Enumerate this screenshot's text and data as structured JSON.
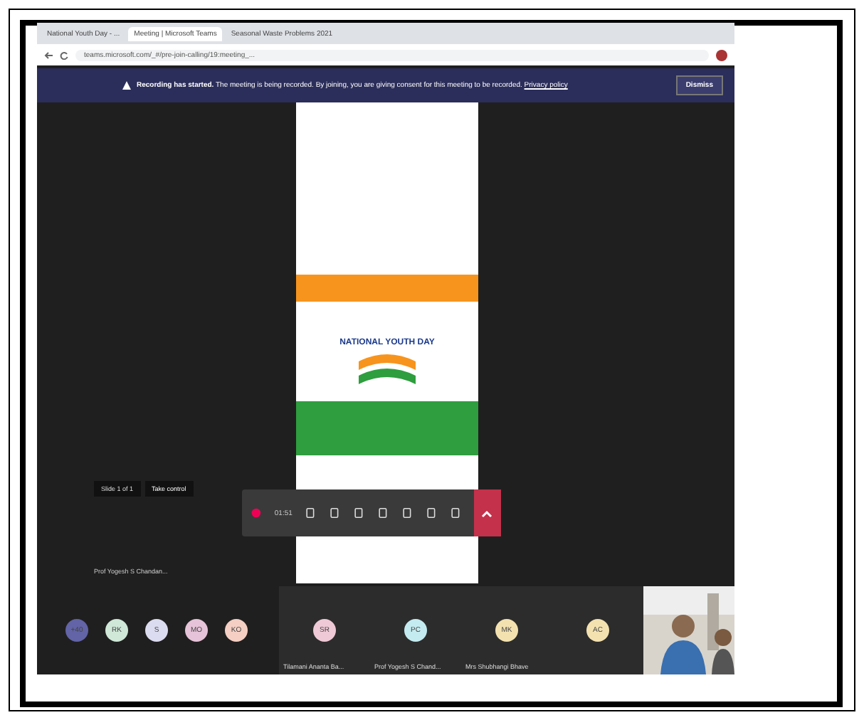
{
  "browser": {
    "tabs": [
      {
        "title": "National Youth Day - ...",
        "selected": false
      },
      {
        "title": "Meeting | Microsoft Teams",
        "selected": true
      },
      {
        "title": "Seasonal Waste Problems 2021",
        "selected": false
      }
    ],
    "address_bar": {
      "url": "teams.microsoft.com/_#/pre-join-calling/19:meeting_..."
    }
  },
  "banner": {
    "title": "Recording has started.",
    "message": "The meeting is being recorded. By joining, you are giving consent for this meeting to be recorded.",
    "link": "Privacy policy",
    "button": "Dismiss"
  },
  "slide": {
    "poster_title": "NATIONAL YOUTH DAY"
  },
  "slide_nav": {
    "label": "Slide 1 of 1",
    "button": "Take control"
  },
  "toolbar": {
    "timer": "01:51"
  },
  "presenter": {
    "name": "Prof Yogesh S Chandan..."
  },
  "participants": [
    {
      "initials": "+40",
      "color": "#6264a7"
    },
    {
      "initials": "RK",
      "color": "#cfe8d8"
    },
    {
      "initials": "S",
      "color": "#dcdcf0"
    },
    {
      "initials": "MO",
      "color": "#e6c3d8"
    },
    {
      "initials": "KO",
      "color": "#f5cfc4"
    },
    {
      "initials": "SR",
      "color": "#efc9d6",
      "name": "Tilamani Ananta Ba..."
    },
    {
      "initials": "PC",
      "color": "#c4ebf0",
      "name": "Prof Yogesh S Chand..."
    },
    {
      "initials": "MK",
      "color": "#f3e2b0",
      "name": "Mrs Shubhangi Bhave"
    },
    {
      "initials": "AC",
      "color": "#f3e2b0"
    }
  ]
}
